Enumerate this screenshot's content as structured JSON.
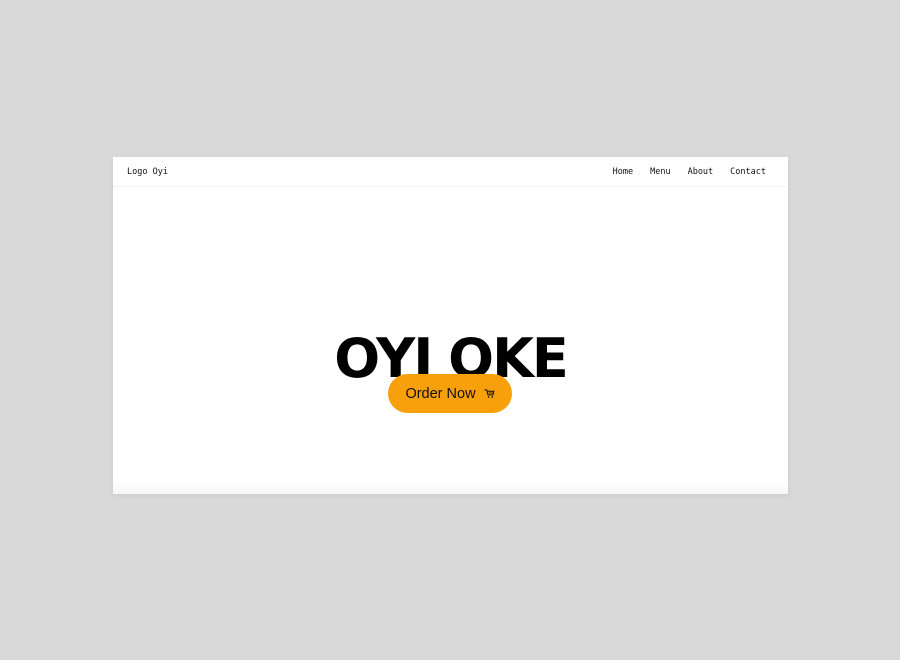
{
  "navbar": {
    "logo": "Logo Oyi",
    "links": [
      {
        "label": "Home"
      },
      {
        "label": "Menu"
      },
      {
        "label": "About"
      },
      {
        "label": "Contact"
      }
    ]
  },
  "hero": {
    "title": "OYI OKE",
    "cta": {
      "label": "Order Now",
      "icon": "shopping-cart-icon"
    }
  },
  "colors": {
    "page_background": "#d9d9d9",
    "card_background": "#ffffff",
    "cta_background": "#f7a00b",
    "text": "#000000"
  }
}
